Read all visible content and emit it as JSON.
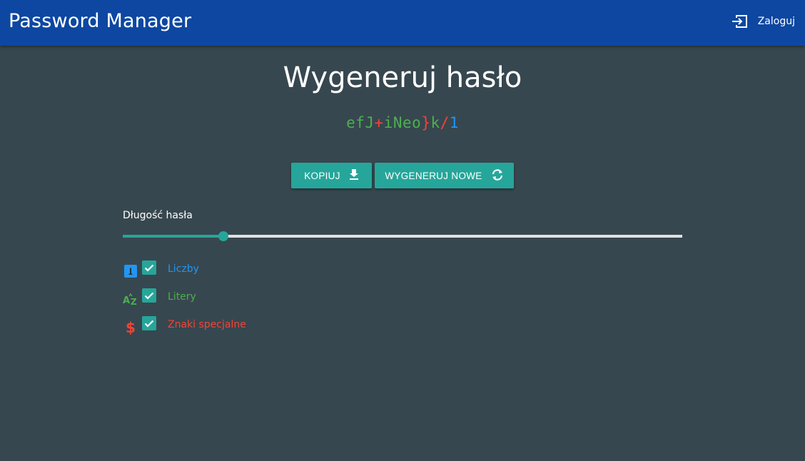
{
  "app": {
    "title": "Password Manager",
    "login_label": "Zaloguj"
  },
  "generator": {
    "heading": "Wygeneruj hasło",
    "password_chars": [
      {
        "c": "e",
        "type": "letter"
      },
      {
        "c": "f",
        "type": "letter"
      },
      {
        "c": "J",
        "type": "letter"
      },
      {
        "c": "+",
        "type": "special"
      },
      {
        "c": "i",
        "type": "letter"
      },
      {
        "c": "N",
        "type": "letter"
      },
      {
        "c": "e",
        "type": "letter"
      },
      {
        "c": "o",
        "type": "letter"
      },
      {
        "c": "}",
        "type": "special"
      },
      {
        "c": "k",
        "type": "letter"
      },
      {
        "c": "/",
        "type": "special"
      },
      {
        "c": "1",
        "type": "number"
      }
    ],
    "copy_label": "Kopiuj",
    "regenerate_label": "Wygeneruj nowe",
    "length_label": "Długość hasła",
    "length_fraction": 0.18
  },
  "options": [
    {
      "key": "numbers",
      "label": "Liczby",
      "checked": true,
      "icon": "numeric-1-box-icon",
      "color": "#2196f3"
    },
    {
      "key": "letters",
      "label": "Litery",
      "checked": true,
      "icon": "alphabetical-sort-icon",
      "color": "#4caf50"
    },
    {
      "key": "special",
      "label": "Znaki specjalne",
      "checked": true,
      "icon": "dollar-sign-icon",
      "color": "#f44336"
    }
  ],
  "colors": {
    "appbar": "#0d47a1",
    "background": "#37474f",
    "accent": "#26a69a",
    "letter": "#4caf50",
    "number": "#2196f3",
    "special": "#f44336"
  }
}
